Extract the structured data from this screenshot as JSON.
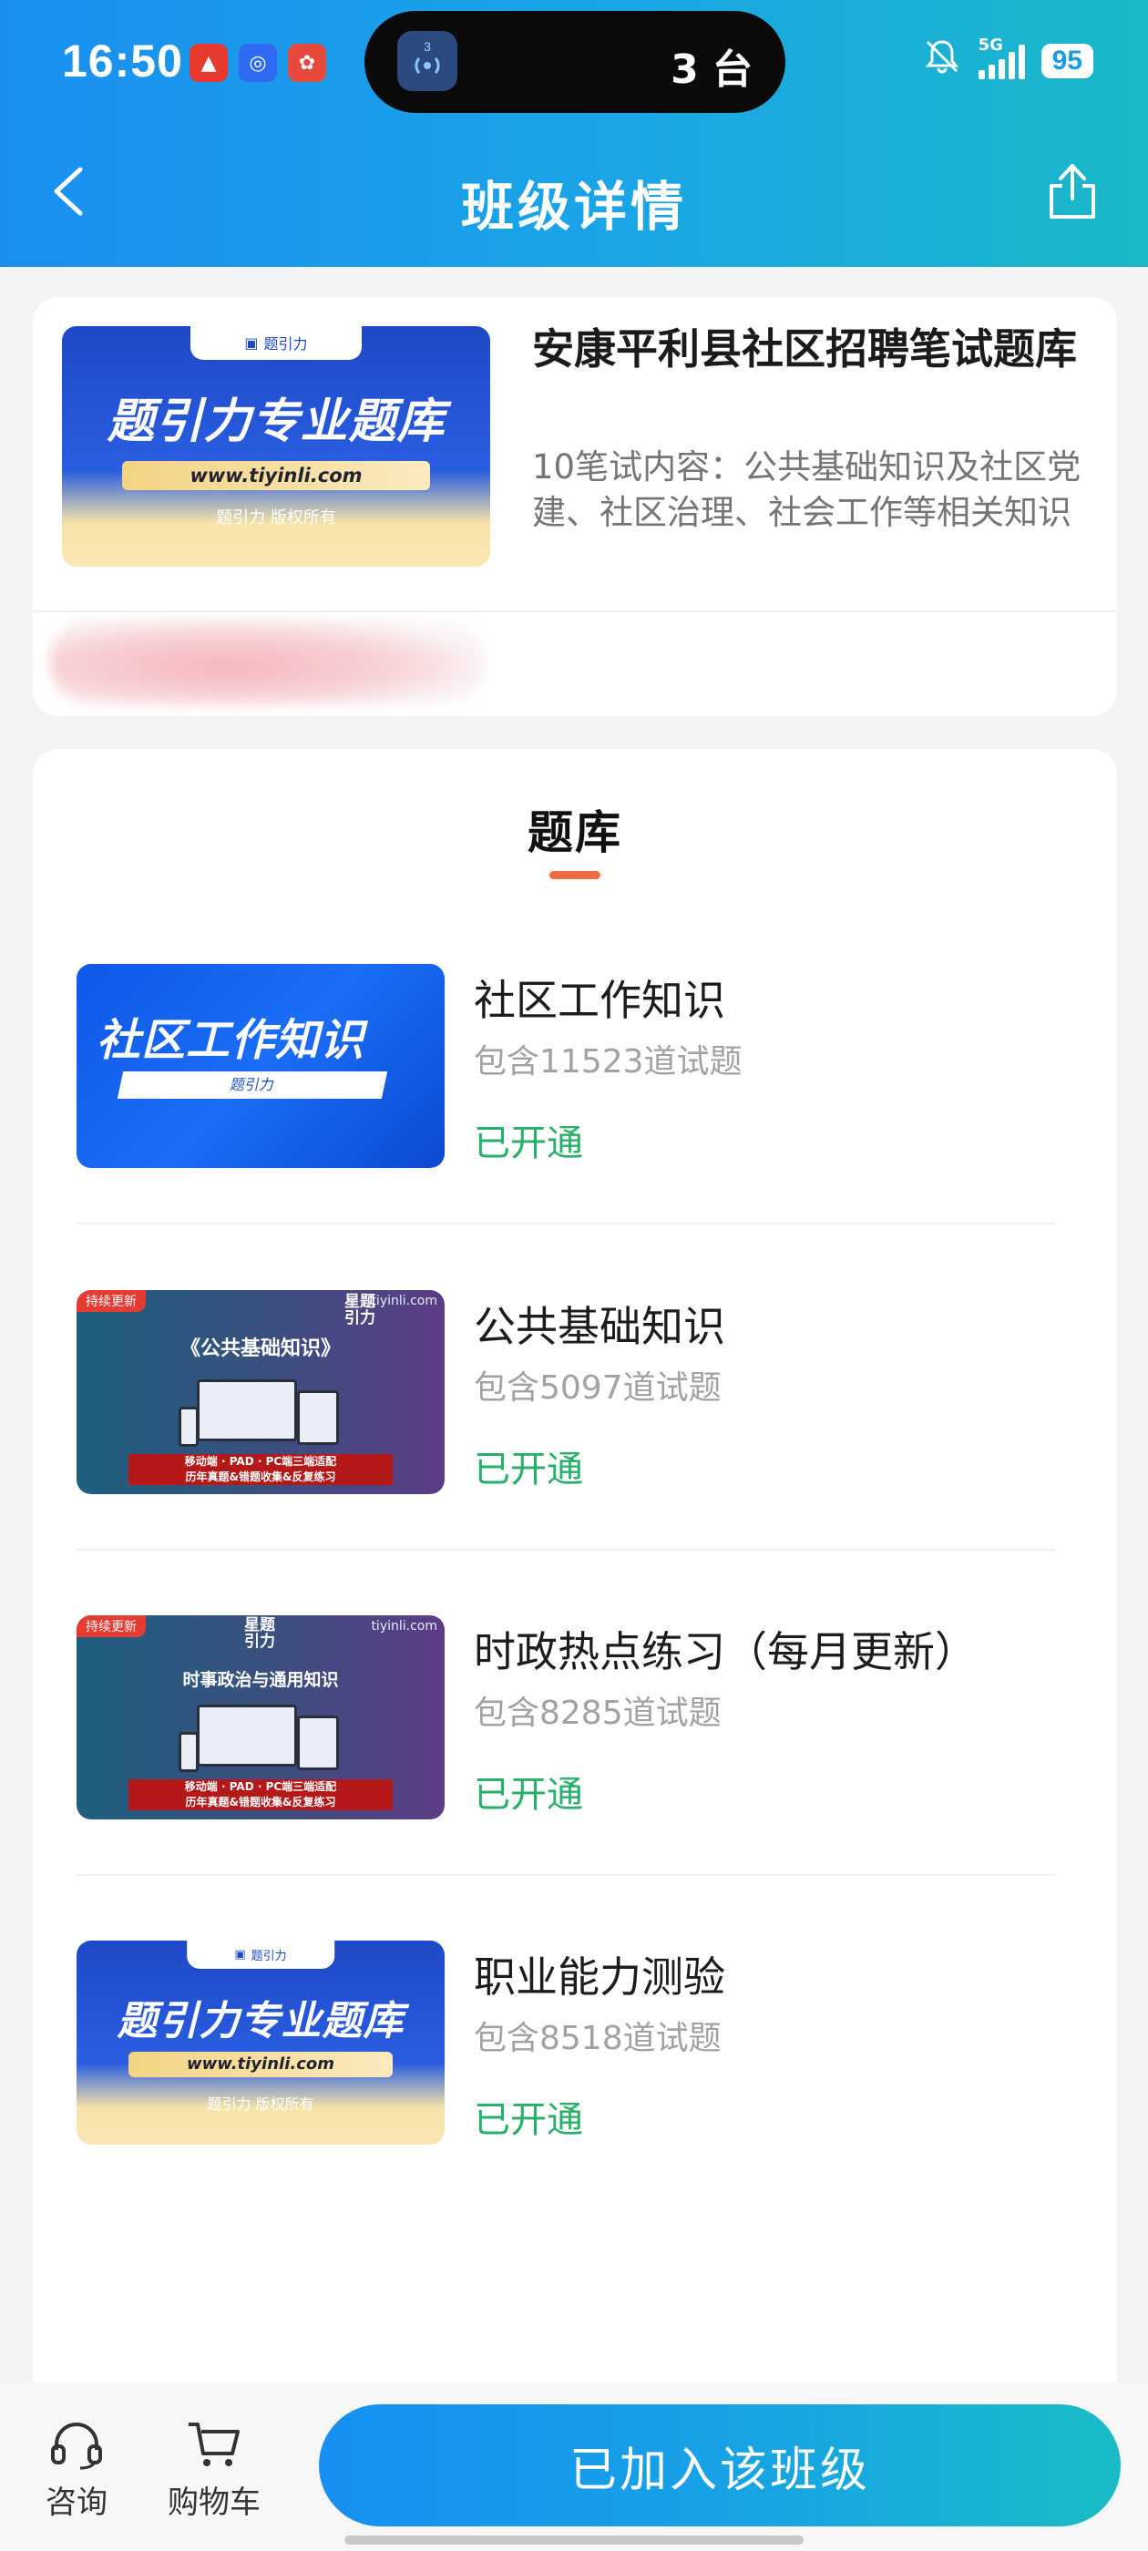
{
  "status_bar": {
    "time": "16:50",
    "island_badge": "3",
    "island_text": "3 台",
    "network": "5G",
    "battery": "95"
  },
  "nav": {
    "title": "班级详情"
  },
  "class_info": {
    "title": "安康平利县社区招聘笔试题库",
    "description": "10笔试内容：公共基础知识及社区党建、社区治理、社会工作等相关知识",
    "thumbnail": {
      "tab_label": "题引力",
      "headline": "题引力专业题库",
      "url": "www.tiyinli.com",
      "copyright": "题引力 版权所有"
    }
  },
  "question_bank": {
    "section_title": "题库",
    "items": [
      {
        "name": "社区工作知识",
        "count": "包含11523道试题",
        "status": "已开通",
        "thumb": {
          "headline": "社区工作知识",
          "band": "题引力"
        }
      },
      {
        "name": "公共基础知识",
        "count": "包含5097道试题",
        "status": "已开通",
        "thumb": {
          "tag": "持续更新",
          "site": "tiyinli.com",
          "logo": "星题引力",
          "title": "《公共基础知识》",
          "banner_line1": "移动端 · PAD · PC端三端适配",
          "banner_line2": "历年真题&错题收集&反复练习"
        }
      },
      {
        "name": "时政热点练习（每月更新）",
        "count": "包含8285道试题",
        "status": "已开通",
        "thumb": {
          "tag": "持续更新",
          "site": "tiyinli.com",
          "logo": "星题引力",
          "title": "时事政治与通用知识",
          "banner_line1": "移动端 · PAD · PC端三端适配",
          "banner_line2": "历年真题&错题收集&反复练习"
        }
      },
      {
        "name": "职业能力测验",
        "count": "包含8518道试题",
        "status": "已开通",
        "thumb": {
          "tab_label": "题引力",
          "headline": "题引力专业题库",
          "url": "www.tiyinli.com",
          "copyright": "题引力 版权所有"
        }
      }
    ]
  },
  "bottom_bar": {
    "consult_label": "咨询",
    "cart_label": "购物车",
    "join_label": "已加入该班级"
  },
  "colors": {
    "header_gradient": [
      "#1a8ff0",
      "#1ab8c8"
    ],
    "accent_underline": "#f06a3e",
    "status_open": "#27b06a"
  },
  "icons": {
    "back": "chevron-left-icon",
    "share": "share-icon",
    "consult": "headset-icon",
    "cart": "cart-icon"
  }
}
